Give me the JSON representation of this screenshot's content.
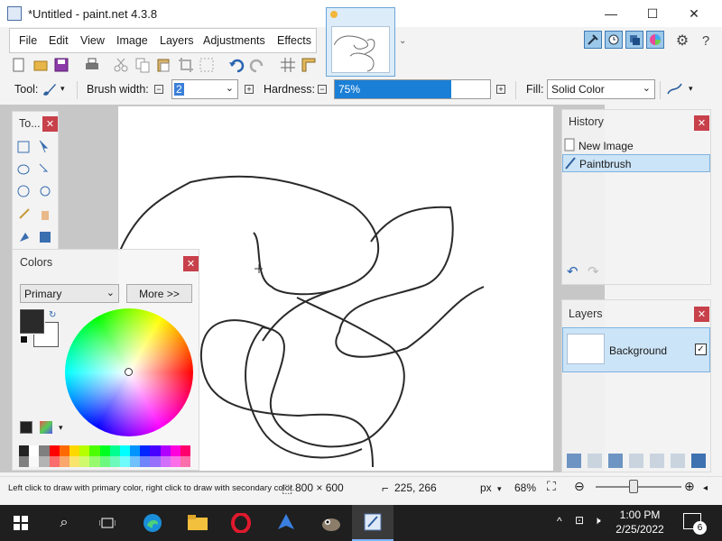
{
  "window": {
    "title": "*Untitled - paint.net 4.3.8",
    "minimize": "—",
    "maximize": "☐",
    "close": "✕"
  },
  "menu": {
    "items": [
      "File",
      "Edit",
      "View",
      "Image",
      "Layers",
      "Adjustments",
      "Effects"
    ]
  },
  "tool_options": {
    "tool_label": "Tool:",
    "brush_width_label": "Brush width:",
    "brush_width_value": "2",
    "hardness_label": "Hardness:",
    "hardness_value": "75%",
    "hardness_fraction": 0.75,
    "fill_label": "Fill:",
    "fill_value": "Solid Color"
  },
  "tools_panel": {
    "title": "To..."
  },
  "colors_panel": {
    "title": "Colors",
    "mode": "Primary",
    "more_label": "More >>",
    "primary_color": "#2a2a2a",
    "secondary_color": "#ffffff",
    "palette": [
      "#222222",
      "#ffffff",
      "#7f7f7f",
      "#ff0000",
      "#ff6a00",
      "#ffd800",
      "#b6ff00",
      "#4cff00",
      "#00ff21",
      "#00ff90",
      "#00ffff",
      "#0094ff",
      "#0026ff",
      "#4800ff",
      "#b200ff",
      "#ff00dc",
      "#ff006e"
    ]
  },
  "history_panel": {
    "title": "History",
    "items": [
      {
        "label": "New Image",
        "icon": "new-image-icon"
      },
      {
        "label": "Paintbrush",
        "icon": "paintbrush-icon"
      }
    ]
  },
  "layers_panel": {
    "title": "Layers",
    "layers": [
      {
        "name": "Background",
        "visible": true
      }
    ]
  },
  "status": {
    "hint": "Left click to draw with primary color, right click to draw with secondary color.",
    "image_size": "800 × 600",
    "cursor_pos": "225, 266",
    "units": "px",
    "zoom": "68%"
  },
  "taskbar": {
    "time": "1:00 PM",
    "date": "2/25/2022",
    "notification_count": "6"
  }
}
